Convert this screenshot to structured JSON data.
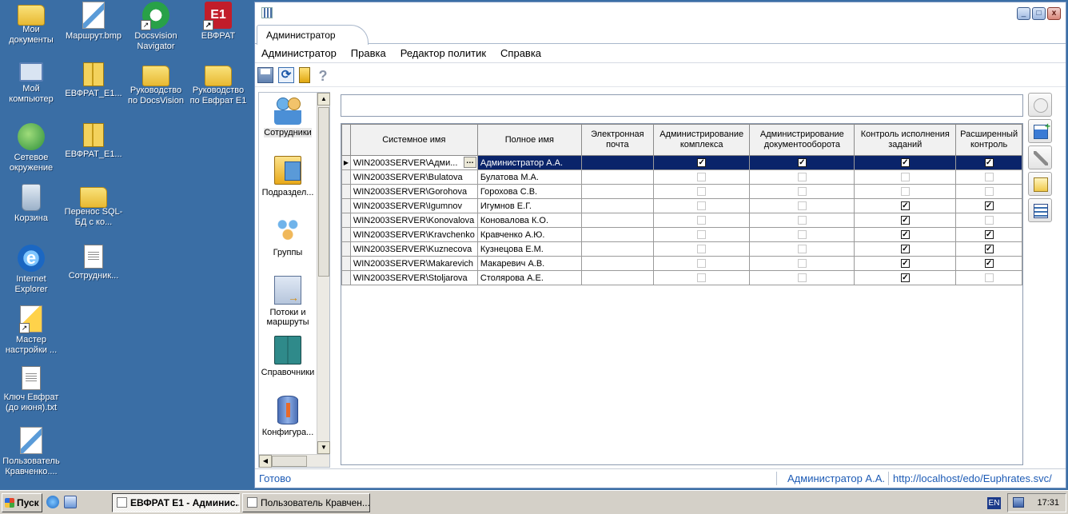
{
  "desktop": {
    "icons": [
      {
        "label": "Мои документы",
        "glyph": "folder-docs-icon"
      },
      {
        "label": "Маршрут.bmp",
        "glyph": "bitmap-file-icon"
      },
      {
        "label": "Docsvision Navigator",
        "glyph": "docsvision-icon"
      },
      {
        "label": "ЕВФРАТ",
        "glyph": "e1-icon"
      },
      {
        "label": "Мой компьютер",
        "glyph": "computer-icon"
      },
      {
        "label": "ЕВФРАТ_Е1...",
        "glyph": "zip-icon"
      },
      {
        "label": "Руководство по DocsVision",
        "glyph": "folder-icon"
      },
      {
        "label": "Руководство по Евфрат Е1",
        "glyph": "folder-icon"
      },
      {
        "label": "Сетевое окружение",
        "glyph": "network-icon"
      },
      {
        "label": "ЕВФРАТ_Е1...",
        "glyph": "zip-icon"
      },
      {
        "label": "Корзина",
        "glyph": "recycle-bin-icon"
      },
      {
        "label": "Перенос SQL-БД с ко...",
        "glyph": "folder-icon"
      },
      {
        "label": "Internet Explorer",
        "glyph": "ie-icon"
      },
      {
        "label": "Сотрудник...",
        "glyph": "text-file-icon"
      },
      {
        "label": "Мастер настройки ...",
        "glyph": "wizard-icon"
      },
      {
        "label": "Ключ Евфрат (до июня).txt",
        "glyph": "text-file-icon"
      },
      {
        "label": "Пользователь Кравченко....",
        "glyph": "user-file-icon"
      }
    ]
  },
  "window": {
    "tab_label": "Администратор",
    "buttons": {
      "minimize": "_",
      "maximize": "□",
      "close": "x"
    }
  },
  "menu": [
    "Администратор",
    "Правка",
    "Редактор политик",
    "Справка"
  ],
  "toolbar": {
    "icons": [
      "save-icon",
      "refresh-icon",
      "properties-icon",
      "help-icon"
    ],
    "help_glyph": "?",
    "refresh_glyph": "⟳"
  },
  "nav": {
    "items": [
      {
        "label": "Сотрудники",
        "icon": "employees-icon"
      },
      {
        "label": "Подраздел...",
        "icon": "departments-icon"
      },
      {
        "label": "Группы",
        "icon": "groups-icon"
      },
      {
        "label": "Потоки и маршруты",
        "icon": "flows-icon"
      },
      {
        "label": "Справочники",
        "icon": "directories-icon"
      },
      {
        "label": "Конфигура...",
        "icon": "configuration-icon"
      }
    ],
    "up": "▲",
    "down": "▼",
    "left": "◀",
    "right": "▶"
  },
  "filter": {
    "value": ""
  },
  "grid": {
    "columns": [
      "Системное имя",
      "Полное имя",
      "Электронная почта",
      "Администрирование комплекса",
      "Администрирование документооборота",
      "Контроль исполнения заданий",
      "Расширенный контроль"
    ],
    "ellipsis": "…",
    "row_marker": "▶",
    "rows": [
      {
        "sys": "WIN2003SERVER\\Адми...",
        "full": "Администратор А.А.",
        "email": "",
        "c1": true,
        "c2": true,
        "c3": true,
        "c4": true,
        "selected": true
      },
      {
        "sys": "WIN2003SERVER\\Bulatova",
        "full": "Булатова М.А.",
        "email": "",
        "c1": false,
        "c2": false,
        "c3": false,
        "c4": false
      },
      {
        "sys": "WIN2003SERVER\\Gorohova",
        "full": "Горохова С.В.",
        "email": "",
        "c1": false,
        "c2": false,
        "c3": false,
        "c4": false
      },
      {
        "sys": "WIN2003SERVER\\Igumnov",
        "full": "Игумнов Е.Г.",
        "email": "",
        "c1": false,
        "c2": false,
        "c3": true,
        "c4": true
      },
      {
        "sys": "WIN2003SERVER\\Konovalova",
        "full": "Коновалова К.О.",
        "email": "",
        "c1": false,
        "c2": false,
        "c3": true,
        "c4": false
      },
      {
        "sys": "WIN2003SERVER\\Kravchenko",
        "full": "Кравченко А.Ю.",
        "email": "",
        "c1": false,
        "c2": false,
        "c3": true,
        "c4": true
      },
      {
        "sys": "WIN2003SERVER\\Kuznecova",
        "full": "Кузнецова Е.М.",
        "email": "",
        "c1": false,
        "c2": false,
        "c3": true,
        "c4": true
      },
      {
        "sys": "WIN2003SERVER\\Makarevich",
        "full": "Макаревич А.В.",
        "email": "",
        "c1": false,
        "c2": false,
        "c3": true,
        "c4": true
      },
      {
        "sys": "WIN2003SERVER\\Stoljarova",
        "full": "Столярова А.Е.",
        "email": "",
        "c1": false,
        "c2": false,
        "c3": true,
        "c4": false
      }
    ]
  },
  "rightbar": {
    "icons": [
      "search-user-icon",
      "add-user-icon",
      "tools-icon",
      "user-card-icon",
      "user-list-icon"
    ]
  },
  "status": {
    "ready": "Готово",
    "user": "Администратор А.А.",
    "url": "http://localhost/edo/Euphrates.svc/"
  },
  "taskbar": {
    "start": "Пуск",
    "tasks": [
      {
        "label": "ЕВФРАТ Е1 - Админис...",
        "active": true
      },
      {
        "label": "Пользователь Кравчен...",
        "active": false
      }
    ],
    "lang": "EN",
    "clock": "17:31"
  },
  "colors": {
    "desktop": "#3a6ea5",
    "selection": "#0a246a",
    "link": "#1d5bb5"
  }
}
